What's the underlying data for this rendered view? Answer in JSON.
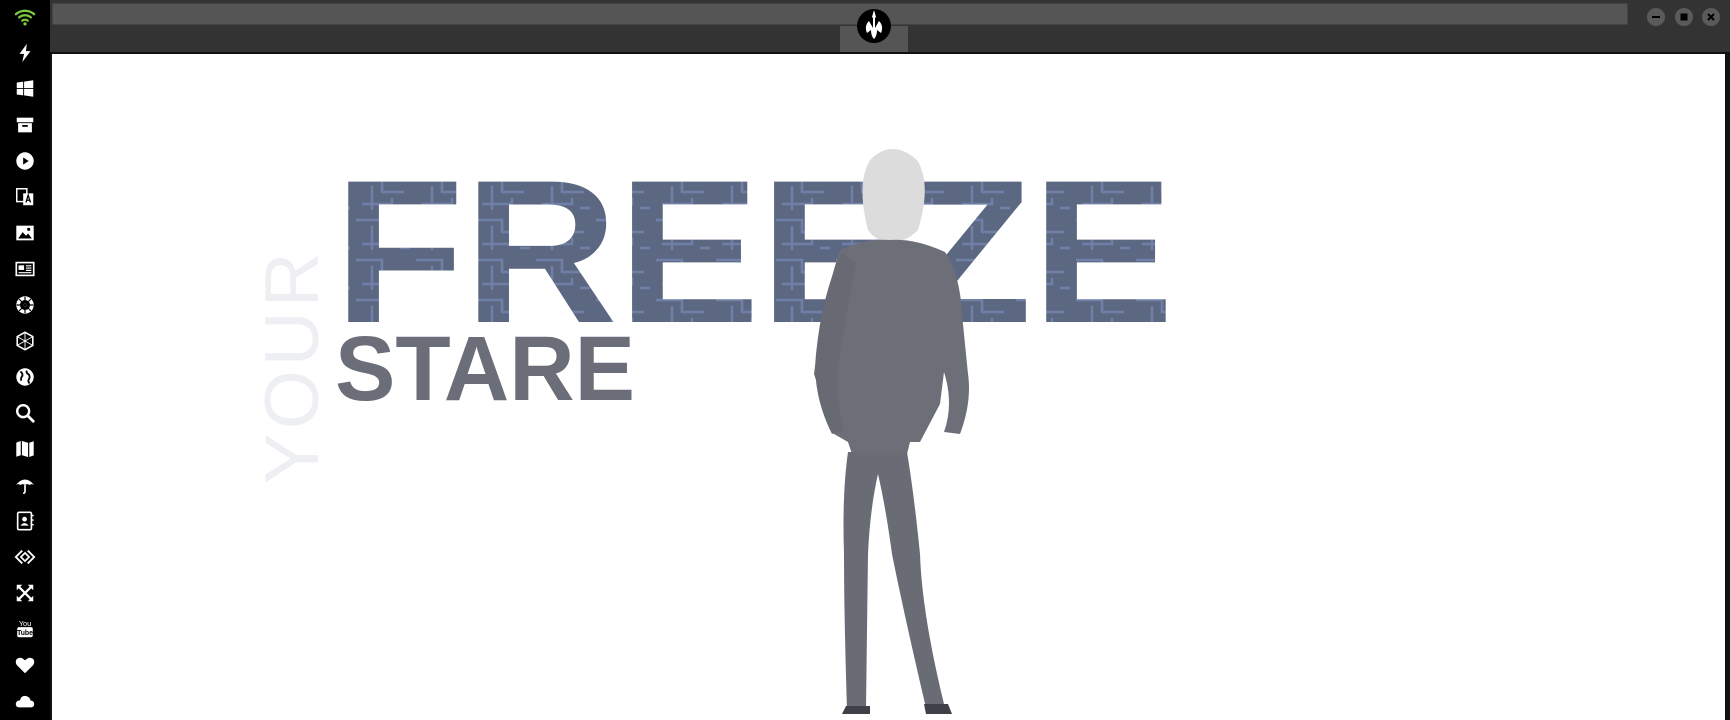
{
  "window": {
    "tab_icon": "rebel-alliance-icon",
    "controls": [
      "minimize-icon",
      "maximize-icon",
      "close-icon"
    ]
  },
  "sidebar": {
    "items": [
      {
        "icon": "wifi-icon"
      },
      {
        "icon": "lightning-icon"
      },
      {
        "icon": "windows-icon"
      },
      {
        "icon": "archive-box-icon"
      },
      {
        "icon": "play-icon"
      },
      {
        "icon": "translate-icon"
      },
      {
        "icon": "image-icon"
      },
      {
        "icon": "newspaper-icon"
      },
      {
        "icon": "empire-icon"
      },
      {
        "icon": "hexagon-network-icon"
      },
      {
        "icon": "globe-icon"
      },
      {
        "icon": "search-icon"
      },
      {
        "icon": "map-icon"
      },
      {
        "icon": "umbrella-icon"
      },
      {
        "icon": "contacts-icon"
      },
      {
        "icon": "code-diamond-icon"
      },
      {
        "icon": "fullscreen-icon"
      },
      {
        "icon": "youtube-icon",
        "text": "You\nTube"
      },
      {
        "icon": "heart-icon"
      },
      {
        "icon": "cloud-icon"
      }
    ],
    "colors": {
      "wifi": "#7ecb3c",
      "icons": "#ffffff",
      "background": "#000000"
    }
  },
  "content": {
    "headline_vertical": "YOUR",
    "headline_main": "FREEZE",
    "headline_sub": "STARE",
    "colors": {
      "vertical_text": "#eeeff3",
      "main_text": "#5c6782",
      "sub_text": "#6b6d78",
      "figure": "#6d6f78",
      "hair": "#dcdcdc"
    }
  }
}
